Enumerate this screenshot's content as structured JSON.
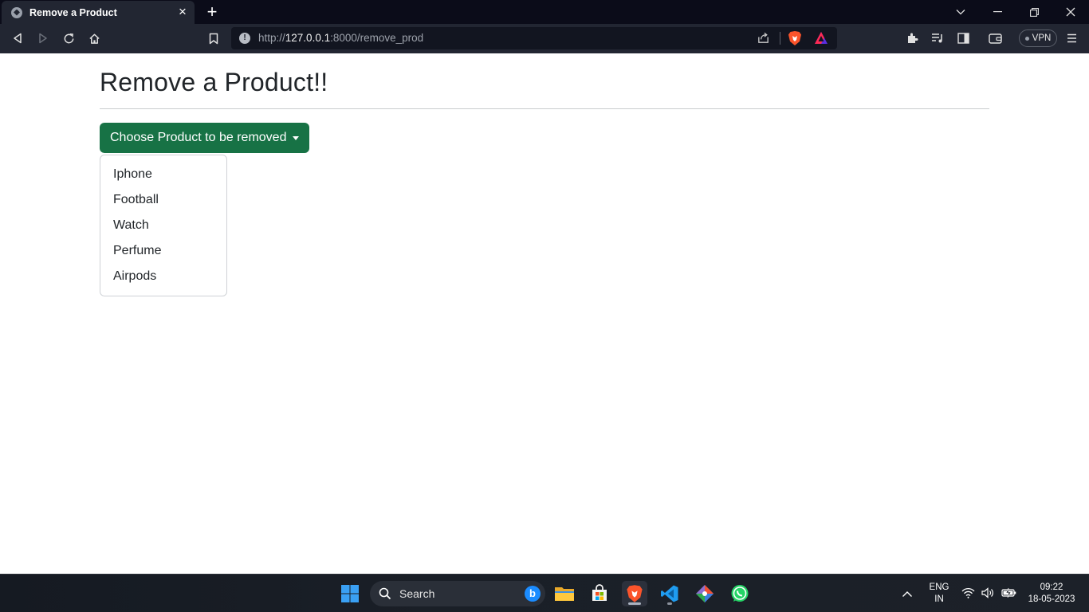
{
  "browser": {
    "tab_title": "Remove a Product",
    "url_prefix": "http://",
    "url_host": "127.0.0.1",
    "url_rest": ":8000/remove_prod",
    "vpn_label": "VPN"
  },
  "page": {
    "title": "Remove a Product!!",
    "dropdown_label": "Choose Product to be removed",
    "dropdown_items": [
      "Iphone",
      "Football",
      "Watch",
      "Perfume",
      "Airpods"
    ],
    "accent_color": "#177245"
  },
  "taskbar": {
    "search_placeholder": "Search",
    "lang_line1": "ENG",
    "lang_line2": "IN",
    "time": "09:22",
    "date": "18-05-2023"
  }
}
